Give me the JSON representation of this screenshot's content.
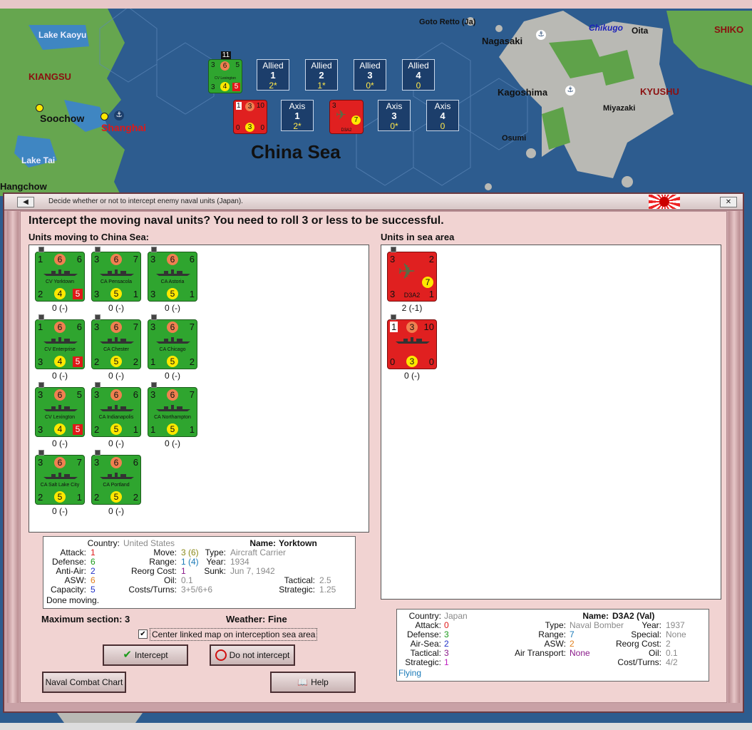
{
  "map": {
    "labels": {
      "lake_kaoyu": "Lake Kaoyu",
      "kiangsu": "KIANGSU",
      "soochow": "Soochow",
      "shanghai": "Shanghai",
      "lake_tai": "Lake Tai",
      "hangchow": "Hangchow",
      "china_sea": "China Sea",
      "goto_retto": "Goto Retto (Ja)",
      "nagasaki": "Nagasaki",
      "chikugo": "Chikugo",
      "oita": "Oita",
      "shikoku": "SHIKO",
      "kagoshima": "Kagoshima",
      "kyushu": "KYUSHU",
      "miyazaki": "Miyazaki",
      "osumi": "Osumi"
    },
    "stack_count": "11",
    "lexington_counter": {
      "tl": "3",
      "tc": "6",
      "tr": "5",
      "bl": "3",
      "bc": "4",
      "br": "5",
      "name": "CV Lexington"
    },
    "axis_ship_counter": {
      "tl": "1",
      "tc": "3",
      "tr": "10",
      "bl": "0",
      "bc": "3",
      "br": "0"
    },
    "axis_air_counter": {
      "tl": "3",
      "br": "7",
      "name": "D3A2"
    },
    "allied_sections": [
      {
        "label": "Allied",
        "num": "1",
        "val": "2*"
      },
      {
        "label": "Allied",
        "num": "2",
        "val": "1*"
      },
      {
        "label": "Allied",
        "num": "3",
        "val": "0*"
      },
      {
        "label": "Allied",
        "num": "4",
        "val": "0"
      }
    ],
    "axis_sections": [
      {
        "label": "Axis",
        "num": "1",
        "val": "2*"
      },
      {
        "label": "Axis",
        "num": "3",
        "val": "0*"
      },
      {
        "label": "Axis",
        "num": "4",
        "val": "0"
      }
    ]
  },
  "dialog": {
    "title": "Decide whether or not to intercept enemy naval units (Japan).",
    "question": "Intercept the moving naval units?  You need to roll 3 or less to be successful.",
    "moving_heading": "Units moving to China Sea:",
    "sea_heading": "Units in sea area",
    "moving_units": [
      {
        "name": "CV Yorktown",
        "tl": "1",
        "tc": "6",
        "tr": "6",
        "bl": "2",
        "bc": "4",
        "br": "5",
        "red_br": true,
        "value": "0 (-)"
      },
      {
        "name": "CA Pensacola",
        "tl": "3",
        "tc": "6",
        "tr": "7",
        "bl": "3",
        "bc": "5",
        "br": "1",
        "red_br": false,
        "value": "0 (-)"
      },
      {
        "name": "CA Astoria",
        "tl": "3",
        "tc": "6",
        "tr": "6",
        "bl": "3",
        "bc": "5",
        "br": "1",
        "red_br": false,
        "value": "0 (-)"
      },
      {
        "name": "CV Enterprise",
        "tl": "1",
        "tc": "6",
        "tr": "6",
        "bl": "3",
        "bc": "4",
        "br": "5",
        "red_br": true,
        "value": "0 (-)"
      },
      {
        "name": "CA Chester",
        "tl": "3",
        "tc": "6",
        "tr": "7",
        "bl": "2",
        "bc": "5",
        "br": "2",
        "red_br": false,
        "value": "0 (-)"
      },
      {
        "name": "CA Chicago",
        "tl": "3",
        "tc": "6",
        "tr": "7",
        "bl": "1",
        "bc": "5",
        "br": "2",
        "red_br": false,
        "value": "0 (-)"
      },
      {
        "name": "CV Lexington",
        "tl": "3",
        "tc": "6",
        "tr": "5",
        "bl": "3",
        "bc": "4",
        "br": "5",
        "red_br": true,
        "value": "0 (-)"
      },
      {
        "name": "CA Indianapolis",
        "tl": "3",
        "tc": "6",
        "tr": "6",
        "bl": "2",
        "bc": "5",
        "br": "1",
        "red_br": false,
        "value": "0 (-)"
      },
      {
        "name": "CA Northampton",
        "tl": "3",
        "tc": "6",
        "tr": "7",
        "bl": "1",
        "bc": "5",
        "br": "1",
        "red_br": false,
        "value": "0 (-)"
      },
      {
        "name": "CA Salt Lake City",
        "tl": "3",
        "tc": "6",
        "tr": "7",
        "bl": "2",
        "bc": "5",
        "br": "1",
        "red_br": false,
        "value": "0 (-)"
      },
      {
        "name": "CA Portland",
        "tl": "3",
        "tc": "6",
        "tr": "6",
        "bl": "2",
        "bc": "5",
        "br": "2",
        "red_br": false,
        "value": "0 (-)"
      }
    ],
    "sea_units": [
      {
        "name": "D3A2",
        "kind": "air",
        "tl": "3",
        "tr": "2",
        "bl": "3",
        "br": "1",
        "bc": "7",
        "value": "2 (-1)"
      },
      {
        "name": "",
        "kind": "ship",
        "tl": "1",
        "tc": "3",
        "tr": "10",
        "bl": "0",
        "bc": "3",
        "br": "0",
        "value": "0 (-)"
      }
    ],
    "allied_info": {
      "country_label": "Country:",
      "country": "United States",
      "attack_label": "Attack:",
      "attack": "1",
      "defense_label": "Defense:",
      "defense": "6",
      "antiair_label": "Anti-Air:",
      "antiair": "2",
      "asw_label": "ASW:",
      "asw": "6",
      "capacity_label": "Capacity:",
      "capacity": "5",
      "status": "Done moving.",
      "move_label": "Move:",
      "move": "3",
      "move_paren": "(6)",
      "range_label": "Range:",
      "range": "1",
      "range_paren": "(4)",
      "reorg_label": "Reorg Cost:",
      "reorg": "1",
      "oil_label": "Oil:",
      "oil": "0.1",
      "costs_label": "Costs/Turns:",
      "costs": "3+5/6+6",
      "name_label": "Name:",
      "name": "Yorktown",
      "type_label": "Type:",
      "type": "Aircraft Carrier",
      "year_label": "Year:",
      "year": "1934",
      "sunk_label": "Sunk:",
      "sunk": "Jun 7, 1942",
      "tactical_label": "Tactical:",
      "tactical": "2.5",
      "strategic_label": "Strategic:",
      "strategic": "1.25"
    },
    "axis_info": {
      "country_label": "Country:",
      "country": "Japan",
      "attack_label": "Attack:",
      "attack": "0",
      "defense_label": "Defense:",
      "defense": "3",
      "airsea_label": "Air-Sea:",
      "airsea": "2",
      "tactical_label": "Tactical:",
      "tactical": "3",
      "strategic_label": "Strategic:",
      "strategic": "1",
      "status": "Flying",
      "name_label": "Name:",
      "name": "D3A2 (Val)",
      "type_label": "Type:",
      "type": "Naval Bomber",
      "range_label": "Range:",
      "range": "7",
      "asw_label": "ASW:",
      "asw": "2",
      "airtransport_label": "Air Transport:",
      "airtransport": "None",
      "year_label": "Year:",
      "year": "1937",
      "special_label": "Special:",
      "special": "None",
      "reorg_label": "Reorg Cost:",
      "reorg": "2",
      "oil_label": "Oil:",
      "oil": "0.1",
      "costs_label": "Cost/Turns:",
      "costs": "4/2"
    },
    "max_section": "Maximum section: 3",
    "weather": "Weather:  Fine",
    "center_checkbox_label": "Center linked map on interception sea area",
    "center_checked": true,
    "intercept_label": "Intercept",
    "no_intercept_label": "Do not intercept",
    "naval_chart_label": "Naval Combat Chart",
    "help_label": "Help"
  },
  "colors": {
    "sea": "#2e5a8c",
    "land": "#5fa24a",
    "allied_counter": "#2fa52f",
    "axis_counter": "#e02020",
    "dialog_bg": "#f1d3d2"
  }
}
